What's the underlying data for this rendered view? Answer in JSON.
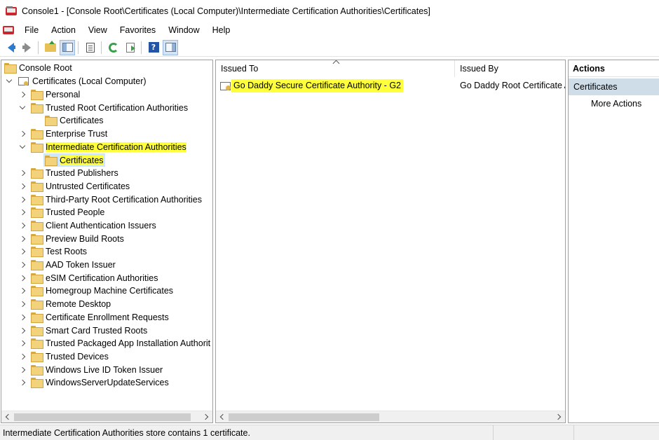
{
  "window": {
    "title": "Console1 - [Console Root\\Certificates (Local Computer)\\Intermediate Certification Authorities\\Certificates]"
  },
  "menubar": {
    "items": [
      "File",
      "Action",
      "View",
      "Favorites",
      "Window",
      "Help"
    ]
  },
  "toolbar": {
    "icons": [
      "back-icon",
      "forward-icon",
      "up-folder-icon",
      "show-tree-icon",
      "properties-icon",
      "refresh-icon",
      "export-list-icon",
      "help-icon",
      "show-actions-pane-icon"
    ]
  },
  "tree": {
    "root": "Console Root",
    "computer": "Certificates (Local Computer)",
    "items": [
      {
        "label": "Personal"
      },
      {
        "label": "Trusted Root Certification Authorities",
        "expanded": true,
        "child": "Certificates"
      },
      {
        "label": "Enterprise Trust"
      },
      {
        "label": "Intermediate Certification Authorities",
        "expanded": true,
        "highlighted": true,
        "child": "Certificates"
      },
      {
        "label": "Trusted Publishers"
      },
      {
        "label": "Untrusted Certificates"
      },
      {
        "label": "Third-Party Root Certification Authorities"
      },
      {
        "label": "Trusted People"
      },
      {
        "label": "Client Authentication Issuers"
      },
      {
        "label": "Preview Build Roots"
      },
      {
        "label": "Test Roots"
      },
      {
        "label": "AAD Token Issuer"
      },
      {
        "label": "eSIM Certification Authorities"
      },
      {
        "label": "Homegroup Machine Certificates"
      },
      {
        "label": "Remote Desktop"
      },
      {
        "label": "Certificate Enrollment Requests"
      },
      {
        "label": "Smart Card Trusted Roots"
      },
      {
        "label": "Trusted Packaged App Installation Authorit"
      },
      {
        "label": "Trusted Devices"
      },
      {
        "label": "Windows Live ID Token Issuer"
      },
      {
        "label": "WindowsServerUpdateServices"
      }
    ]
  },
  "list": {
    "columns": [
      "Issued To",
      "Issued By"
    ],
    "rows": [
      {
        "issued_to": "Go Daddy Secure Certificate Authority - G2",
        "issued_by": "Go Daddy Root Certificate A"
      }
    ]
  },
  "actions": {
    "title": "Actions",
    "section": "Certificates",
    "more": "More Actions"
  },
  "status": {
    "text": "Intermediate Certification Authorities store contains 1 certificate."
  },
  "colors": {
    "highlight": "#ffff3b",
    "selection": "#cce8ff",
    "actions_section": "#cfdde9"
  }
}
